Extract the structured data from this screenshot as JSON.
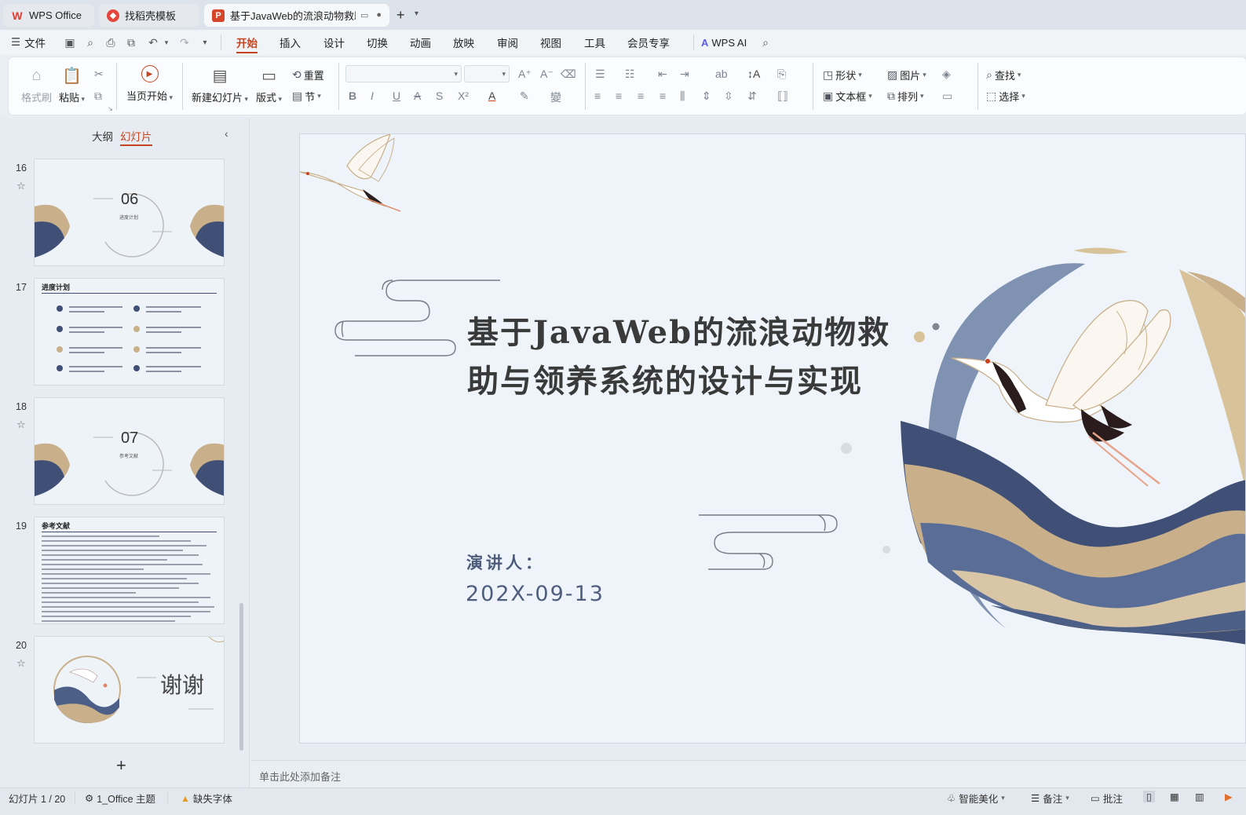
{
  "tabs": [
    {
      "label": "WPS Office",
      "icon": "wps-logo-icon"
    },
    {
      "label": "找稻壳模板",
      "icon": "docer-icon"
    },
    {
      "label": "基于JavaWeb的流浪动物救助",
      "icon": "ppt-file-icon"
    }
  ],
  "menubar": {
    "file": "文件",
    "items": [
      "开始",
      "插入",
      "设计",
      "切换",
      "动画",
      "放映",
      "审阅",
      "视图",
      "工具",
      "会员专享"
    ],
    "active": "开始",
    "ai": "WPS AI"
  },
  "ribbon": {
    "format_painter": "格式刷",
    "paste": "粘贴",
    "from_current": "当页开始",
    "new_slide": "新建幻灯片",
    "layout": "版式",
    "reset": "重置",
    "section": "节",
    "shape": "形状",
    "picture": "图片",
    "textbox": "文本框",
    "arrange": "排列",
    "find": "查找",
    "select": "选择"
  },
  "left_panel": {
    "tab_outline": "大纲",
    "tab_slides": "幻灯片",
    "slides": [
      {
        "num": "16",
        "label_num": "06",
        "label_text": "进度计划"
      },
      {
        "num": "17",
        "title": "进度计划"
      },
      {
        "num": "18",
        "label_num": "07",
        "label_text": "参考文献"
      },
      {
        "num": "19",
        "title": "参考文献"
      },
      {
        "num": "20",
        "thanks": "谢谢"
      }
    ]
  },
  "slide": {
    "title": "基于JavaWeb的流浪动物救助与领养系统的设计与实现",
    "speaker": "演讲人：",
    "date": "202X-09-13"
  },
  "notes": {
    "placeholder": "单击此处添加备注"
  },
  "status": {
    "slide_counter": "幻灯片 1 / 20",
    "theme": "1_Office 主题",
    "missing_font": "缺失字体",
    "beautify": "智能美化",
    "notes": "备注",
    "comments": "批注"
  },
  "colors": {
    "accent": "#c8431f",
    "navy": "#3f4f75",
    "gold": "#c9b08a"
  }
}
